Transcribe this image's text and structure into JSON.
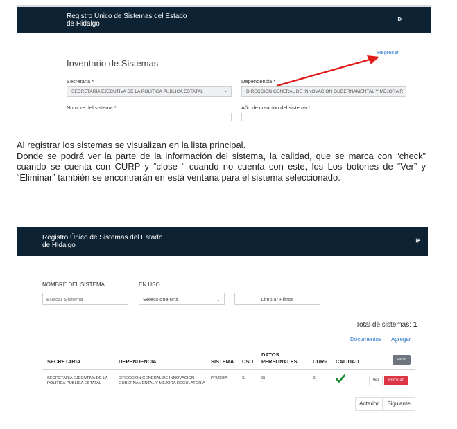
{
  "screenshot1": {
    "header_title": "Registro Único de Sistemas del Estado de Hidalgo",
    "header_title_line1": "Registro Único de Sistemas del Estado",
    "header_title_line2": "de Hidalgo",
    "logout_icon": "sign-out-icon",
    "back_link": "Regresar",
    "page_title": "Inventario de Sistemas",
    "secretaria_label": "Secretaria",
    "secretaria_value": "SECRETARÍA EJECUTIVA DE LA POLÍTICA PÚBLICA ESTATAL",
    "dependencia_label": "Dependencia",
    "dependencia_value": "DIRECCIÓN GENERAL DE INNOVACIÓN GUBERNAMENTAL Y MEJORA R",
    "nombre_label": "Nombre del sistema",
    "anio_label": "Año de creación del sistema",
    "required_mark": "*",
    "arrow_color": "#e01b1b"
  },
  "paragraph": {
    "line1": "Al registrar los sistemas se visualizan en la lista principal.",
    "line2": "Donde se podrá ver la parte de la información del sistema, la calidad, que se marca con “check” cuando se cuenta con CURP y “close “ cuando no cuenta con este, los Los botones de “Ver” y “Eliminar” también se encontrarán en está ventana para el sistema seleccionado."
  },
  "screenshot2": {
    "header_title_line1": "Registro Único de Sistemas del Estado",
    "header_title_line2": "de Hidalgo",
    "logout_icon": "sign-out-icon",
    "filters": {
      "nombre_label": "NOMBRE DEL SISTEMA",
      "nombre_placeholder": "Buscar Sistema",
      "en_uso_label": "EN USO",
      "en_uso_value": "Seleccione una",
      "clear_button": "Limpiar Filtros"
    },
    "total_label": "Total de sistemas:",
    "total_value": "1",
    "documentos_link": "Documentos",
    "agregar_link": "Agregar",
    "columns": [
      "SECRETARIA",
      "DEPENDENCIA",
      "SISTEMA",
      "USO",
      "DATOS PERSONALES",
      "CURP",
      "CALIDAD"
    ],
    "col_datos_line1": "DATOS",
    "col_datos_line2": "PERSONALES",
    "excel_button": "Excel",
    "row": {
      "secretaria_line1": "SECRETARÍA EJECUTIVA DE LA",
      "secretaria_line2": "POLÍTICA PÚBLICA ESTATAL",
      "dependencia_line1": "DIRECCIÓN GENERAL DE INNOVACIÓN",
      "dependencia_line2": "GUBERNAMENTAL Y MEJORA REGULATORIA",
      "sistema": "PRUEBA",
      "uso": "Si",
      "datos": "Si",
      "curp": "SI",
      "calidad_icon": "check-icon",
      "ver_button": "Ver",
      "eliminar_button": "Eliminar"
    },
    "prev_button": "Anterior",
    "next_button": "Siguiente",
    "check_color": "#1e8a2e",
    "danger_color": "#dc3545",
    "link_color": "#2a77c9"
  }
}
